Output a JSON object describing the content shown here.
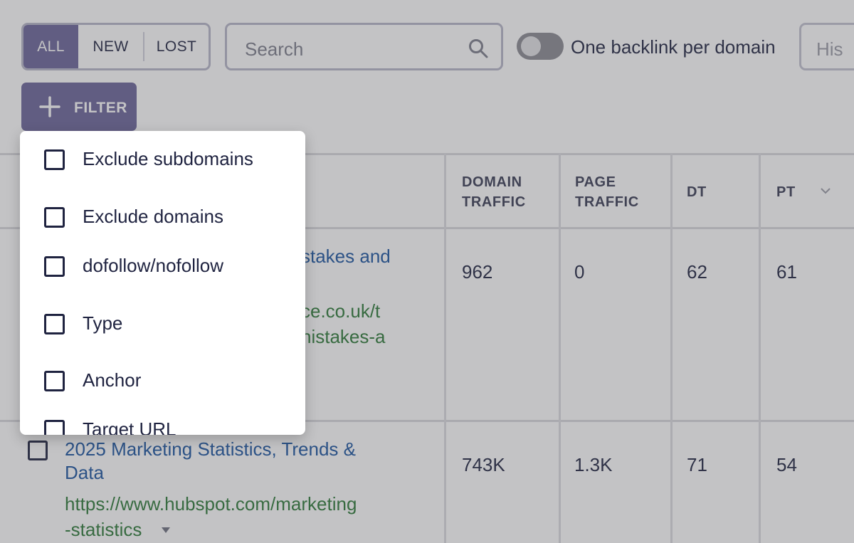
{
  "toolbar": {
    "segment": {
      "all": "ALL",
      "new": "NEW",
      "lost": "LOST",
      "active": "ALL"
    },
    "search": {
      "placeholder": "Search"
    },
    "toggle": {
      "label": "One backlink per domain",
      "on": false
    },
    "history": {
      "label": "His"
    },
    "filter": {
      "label": "FILTER"
    }
  },
  "table": {
    "headers": {
      "domain_traffic": [
        "DOMAIN",
        "TRAFFIC"
      ],
      "page_traffic": [
        "PAGE",
        "TRAFFIC"
      ],
      "dt": "DT",
      "pt": "PT"
    },
    "rows": [
      {
        "title_fragment": "stakes and",
        "url_fragments": [
          "ce.co.uk/t",
          "nistakes-a"
        ],
        "domain_traffic": "962",
        "page_traffic": "0",
        "dt": "62",
        "pt": "61"
      },
      {
        "title": [
          "2025 Marketing Statistics, Trends &",
          "Data"
        ],
        "url": [
          "https://www.hubspot.com/marketing",
          "-statistics"
        ],
        "domain_traffic": "743K",
        "page_traffic": "1.3K",
        "dt": "71",
        "pt": "54"
      }
    ]
  },
  "filter_menu": {
    "items": [
      {
        "label": "Exclude subdomains",
        "checked": false
      },
      {
        "label": "Exclude domains",
        "checked": false
      },
      {
        "label": "dofollow/nofollow",
        "checked": false
      },
      {
        "label": "Type",
        "checked": false
      },
      {
        "label": "Anchor",
        "checked": false
      },
      {
        "label": "Target URL",
        "checked": false
      }
    ]
  },
  "colors": {
    "accent": "#6b6499",
    "link": "#1a54a0",
    "url": "#2c7a38"
  },
  "icons": {
    "search": "search-icon",
    "filter": "plus-icon",
    "sort": "chevron-down-icon",
    "url_menu": "caret-down-icon"
  }
}
